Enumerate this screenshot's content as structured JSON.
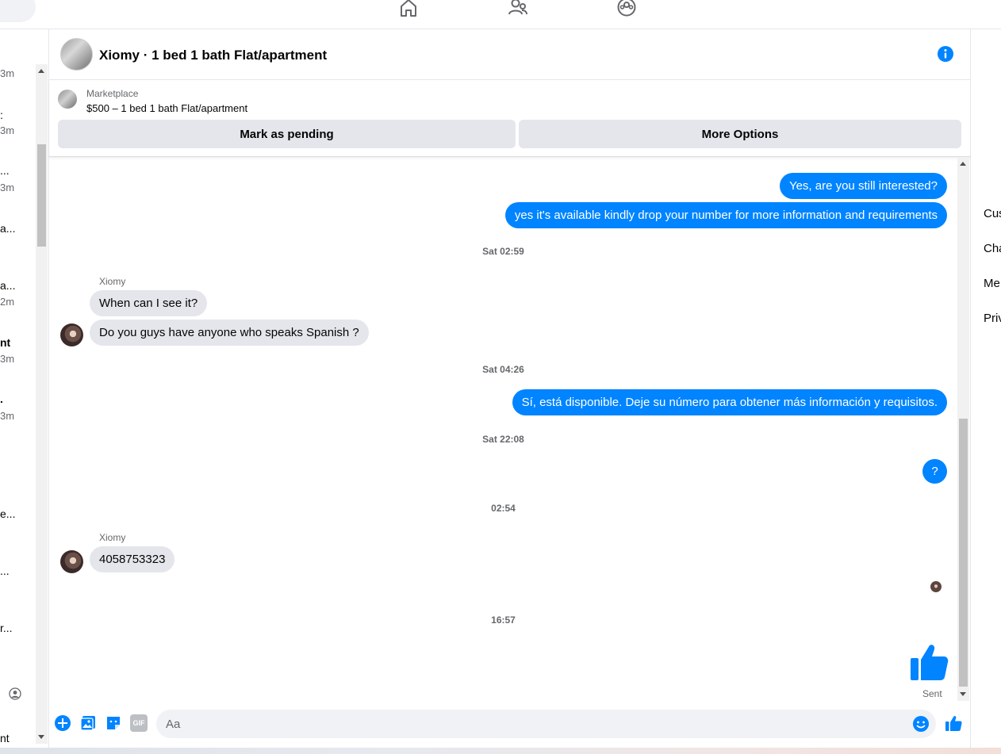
{
  "left_list": {
    "items": [
      {
        "snippet": "",
        "time": "3m"
      },
      {
        "snippet": ":",
        "time": "3m"
      },
      {
        "snippet": "...",
        "time": "3m"
      },
      {
        "snippet": "a...",
        "time": ""
      },
      {
        "snippet": "a...",
        "time": "2m"
      },
      {
        "snippet": "nt",
        "time": "3m"
      },
      {
        "snippet": ".",
        "time": "3m"
      },
      {
        "snippet": "e...",
        "time": ""
      },
      {
        "snippet": "...",
        "time": ""
      },
      {
        "snippet": "r...",
        "time": ""
      },
      {
        "snippet": "nt",
        "time": ""
      }
    ]
  },
  "chat": {
    "title": "Xiomy · 1 bed 1 bath Flat/apartment",
    "marketplace": {
      "label": "Marketplace",
      "listing": "$500 – 1 bed 1 bath Flat/apartment",
      "mark_pending_label": "Mark as pending",
      "more_options_label": "More Options"
    },
    "messages": {
      "out1": "Yes, are you still interested?",
      "out2": "yes it's available kindly drop your number for more information and requirements",
      "ts1": "Sat 02:59",
      "sender1": "Xiomy",
      "in1": "When can I see it?",
      "in2": "Do you guys have anyone who speaks Spanish ?",
      "ts2": "Sat 04:26",
      "out3": "Sí, está disponible. Deje su número para obtener más información y requisitos.",
      "ts3": "Sat 22:08",
      "out4": "?",
      "ts4": "02:54",
      "sender2": "Xiomy",
      "in3": "4058753323",
      "ts5": "16:57",
      "sent_label": "Sent"
    },
    "composer": {
      "placeholder": "Aa",
      "icons": [
        "plus-icon",
        "photo-icon",
        "sticker-icon",
        "gif-icon",
        "emoji-icon",
        "thumbs-up-icon"
      ],
      "gif_label": "GIF"
    }
  },
  "right_panel": {
    "items": [
      "Cus",
      "Cha",
      "Me",
      "Priv"
    ]
  },
  "colors": {
    "accent": "#0084ff",
    "incoming_bubble": "#e4e6eb",
    "muted_text": "#65676b"
  }
}
